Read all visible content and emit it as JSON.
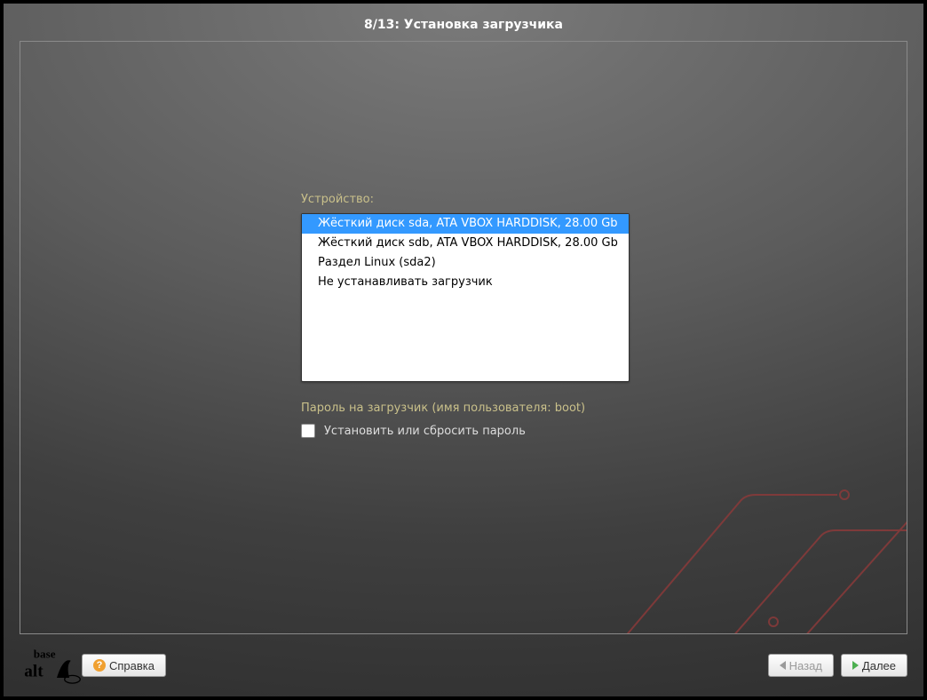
{
  "title": "8/13: Установка загрузчика",
  "device": {
    "label": "Устройство:",
    "options": [
      "Жёсткий диск sda, ATA VBOX HARDDISK,  28.00 Gb",
      "Жёсткий диск sdb, ATA VBOX HARDDISK,  28.00 Gb",
      "Раздел Linux (sda2)",
      "Не устанавливать загрузчик"
    ],
    "selected_index": 0
  },
  "password_section": {
    "label": "Пароль на загрузчик (имя пользователя: boot)",
    "checkbox_label": "Установить или сбросить пароль",
    "checked": false
  },
  "footer": {
    "help": "Справка",
    "back": "Назад",
    "next": "Далее",
    "back_enabled": false,
    "next_enabled": true
  },
  "logo_text": {
    "top": "base",
    "bottom": "alt"
  }
}
